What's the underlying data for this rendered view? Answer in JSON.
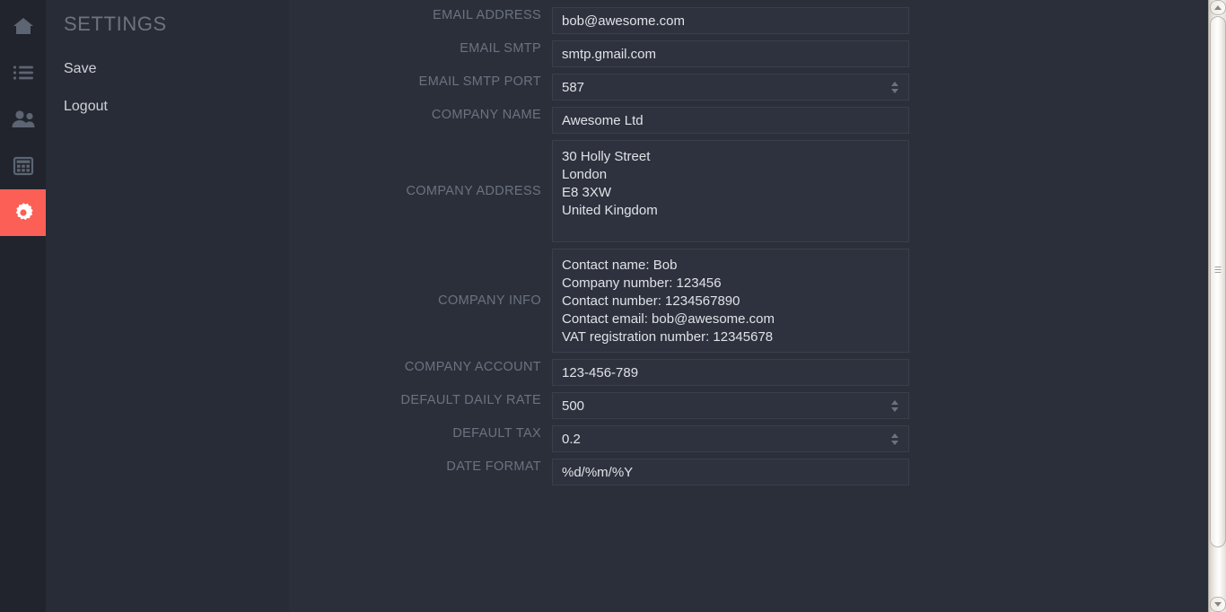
{
  "rail": {
    "items": [
      {
        "name": "home",
        "icon": "home-icon",
        "active": false
      },
      {
        "name": "invoices",
        "icon": "list-icon",
        "active": false
      },
      {
        "name": "clients",
        "icon": "users-icon",
        "active": false
      },
      {
        "name": "timesheet",
        "icon": "table-icon",
        "active": false
      },
      {
        "name": "settings",
        "icon": "gear-icon",
        "active": true
      }
    ],
    "active_color": "#fc5f55",
    "background": "#21242c"
  },
  "sidebar": {
    "title": "SETTINGS",
    "links": [
      {
        "label": "Save"
      },
      {
        "label": "Logout"
      }
    ]
  },
  "form": {
    "fields": [
      {
        "label": "EMAIL ADDRESS",
        "value": "bob@awesome.com",
        "type": "text"
      },
      {
        "label": "EMAIL SMTP",
        "value": "smtp.gmail.com",
        "type": "text"
      },
      {
        "label": "EMAIL SMTP PORT",
        "value": "587",
        "type": "number"
      },
      {
        "label": "COMPANY NAME",
        "value": "Awesome Ltd",
        "type": "text"
      },
      {
        "label": "COMPANY ADDRESS",
        "value": "30 Holly Street\nLondon\nE8 3XW\nUnited Kingdom",
        "type": "textarea"
      },
      {
        "label": "COMPANY INFO",
        "value": "Contact name: Bob\nCompany number: 123456\nContact number: 1234567890\nContact email: bob@awesome.com\nVAT registration number: 12345678",
        "type": "textarea"
      },
      {
        "label": "COMPANY ACCOUNT",
        "value": "123-456-789",
        "type": "text"
      },
      {
        "label": "DEFAULT DAILY RATE",
        "value": "500",
        "type": "number"
      },
      {
        "label": "DEFAULT TAX",
        "value": "0.2",
        "type": "number"
      },
      {
        "label": "DATE FORMAT",
        "value": "%d/%m/%Y",
        "type": "text"
      }
    ]
  },
  "scrollbar": {
    "up_arrow": "scroll-up-arrow",
    "down_arrow": "scroll-down-arrow"
  }
}
